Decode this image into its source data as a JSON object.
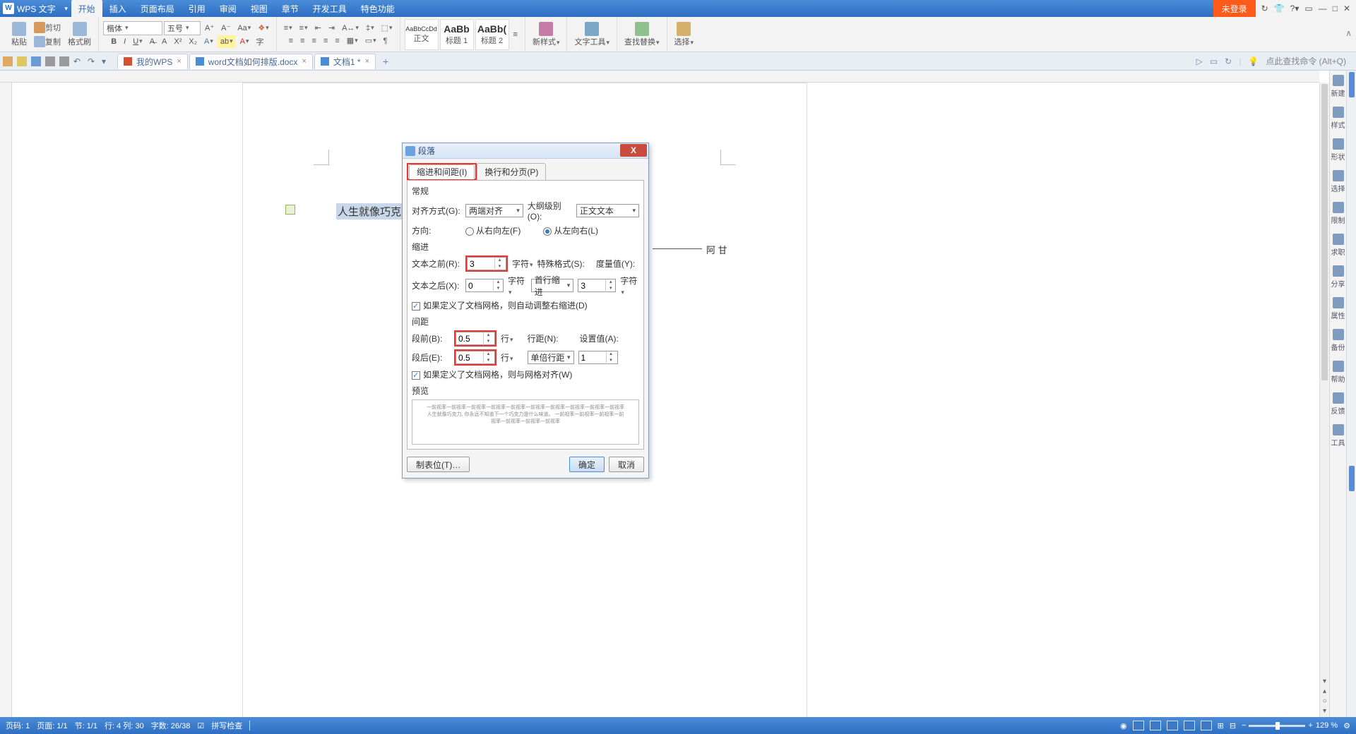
{
  "app": {
    "name": "WPS 文字",
    "unlogin": "未登录"
  },
  "menutabs": [
    "开始",
    "插入",
    "页面布局",
    "引用",
    "审阅",
    "视图",
    "章节",
    "开发工具",
    "特色功能"
  ],
  "active_tab": 0,
  "ribbon": {
    "paste": "粘贴",
    "cut": "剪切",
    "copy": "复制",
    "format_painter": "格式刷",
    "font_name": "楷体",
    "font_size": "五号",
    "style1": "正文",
    "style1_preview": "AaBbCcDd",
    "style2": "标题 1",
    "style2_preview": "AaBb",
    "style3": "标题 2",
    "style3_preview": "AaBb(",
    "new_style": "新样式",
    "text_tools": "文字工具",
    "find_replace": "查找替换",
    "select": "选择",
    "float": "∧"
  },
  "doc_tabs": {
    "t1": "我的WPS",
    "t2": "word文档如何排版.docx",
    "t3": "文档1 *"
  },
  "doctabs_right": {
    "hint": "点此查找命令 (Alt+Q)"
  },
  "page_text": {
    "highlight": "人生就像巧克力,",
    "annotation": "阿 甘"
  },
  "sidebar": [
    {
      "k": "new",
      "l": "新建"
    },
    {
      "k": "style",
      "l": "样式"
    },
    {
      "k": "shape",
      "l": "形状"
    },
    {
      "k": "select",
      "l": "选择"
    },
    {
      "k": "limit",
      "l": "限制"
    },
    {
      "k": "job",
      "l": "求职"
    },
    {
      "k": "share",
      "l": "分享"
    },
    {
      "k": "prop",
      "l": "属性"
    },
    {
      "k": "backup",
      "l": "备份"
    },
    {
      "k": "help",
      "l": "帮助"
    },
    {
      "k": "feedback",
      "l": "反馈"
    },
    {
      "k": "tools",
      "l": "工具"
    }
  ],
  "status": {
    "page_no": "页码: 1",
    "page": "页面: 1/1",
    "section": "节: 1/1",
    "line": "行: 4  列: 30",
    "words": "字数: 26/38",
    "spell": "拼写检查",
    "zoom": "129 %"
  },
  "dialog": {
    "title": "段落",
    "tab1": "缩进和间距(I)",
    "tab2": "换行和分页(P)",
    "groups": {
      "g1": "常规",
      "g2": "缩进",
      "g3": "间距",
      "g4": "预览"
    },
    "labels": {
      "align": "对齐方式(G):",
      "outline": "大纲级别(O):",
      "direction": "方向:",
      "rtl": "从右向左(F)",
      "ltr": "从左向右(L)",
      "before_text": "文本之前(R):",
      "after_text": "文本之后(X):",
      "char": "字符",
      "special": "特殊格式(S):",
      "measure": "度量值(Y):",
      "grid_indent": "如果定义了文档网格，则自动调整右缩进(D)",
      "space_before": "段前(B):",
      "space_after": "段后(E):",
      "line_unit": "行",
      "line_spacing": "行距(N):",
      "set_value": "设置值(A):",
      "grid_align": "如果定义了文档网格，则与网格对齐(W)",
      "tabs": "制表位(T)…",
      "ok": "确定",
      "cancel": "取消"
    },
    "values": {
      "align": "两端对齐",
      "outline": "正文文本",
      "before_text": "3",
      "after_text": "0",
      "special": "首行缩进",
      "measure": "3",
      "space_before": "0.5",
      "space_after": "0.5",
      "line_spacing": "单倍行距",
      "set_value": "1"
    },
    "preview_text": "一前视率一前视率一前视率一前视率一前视率一前视率一前视率一前视率一前视率一前视率\n人生就像巧克力, 你永远不知道下一个巧克力是什么味道。\n一前视率一前视率一前视率一前视率一前视率一前视率一前视率"
  }
}
